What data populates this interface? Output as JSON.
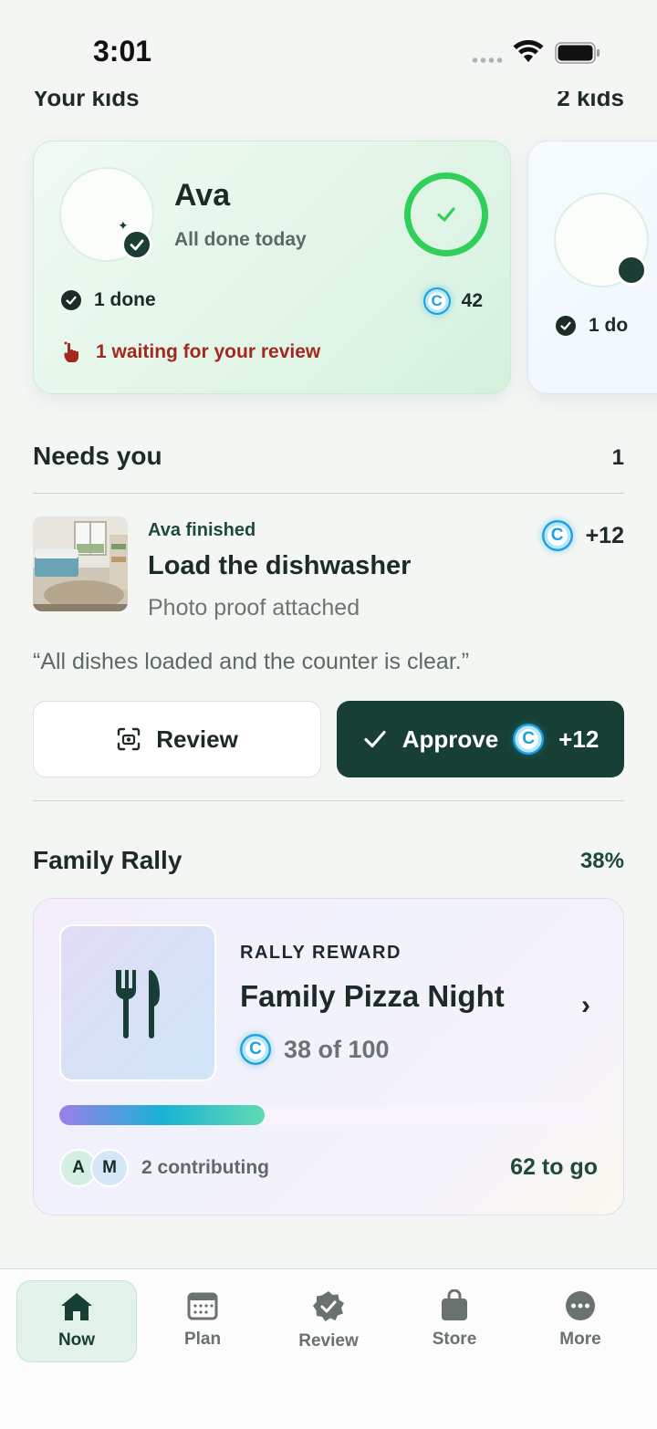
{
  "status_bar": {
    "time": "3:01"
  },
  "kids": {
    "title": "Your kids",
    "count": "2 kids",
    "cards": [
      {
        "name": "Ava",
        "status": "All done today",
        "done": "1 done",
        "coins": "42",
        "waiting": "1 waiting for your review"
      },
      {
        "done": "1 do"
      }
    ]
  },
  "needs_you": {
    "title": "Needs you",
    "count": "1",
    "who": "Ava finished",
    "task": "Load the dishwasher",
    "proof": "Photo proof attached",
    "points": "+12",
    "quote": "“All dishes loaded and the counter is clear.”",
    "review_label": "Review",
    "approve_label": "Approve",
    "approve_points": "+12"
  },
  "rally": {
    "title": "Family Rally",
    "percent": "38%",
    "reward_label": "RALLY REWARD",
    "reward_title": "Family Pizza Night",
    "progress_text": "38 of 100",
    "progress_fraction": 0.38,
    "contributors": [
      "A",
      "M"
    ],
    "contributing": "2 contributing",
    "to_go": "62 to go"
  },
  "tabbar": {
    "items": [
      {
        "label": "Now",
        "icon": "home-icon"
      },
      {
        "label": "Plan",
        "icon": "calendar-icon"
      },
      {
        "label": "Review",
        "icon": "badge-check-icon"
      },
      {
        "label": "Store",
        "icon": "bag-icon"
      },
      {
        "label": "More",
        "icon": "more-icon"
      }
    ]
  },
  "colors": {
    "accent_dark": "#173f35",
    "success": "#2fcf5a",
    "alert": "#a3291f",
    "coin": "#1ba3df"
  }
}
